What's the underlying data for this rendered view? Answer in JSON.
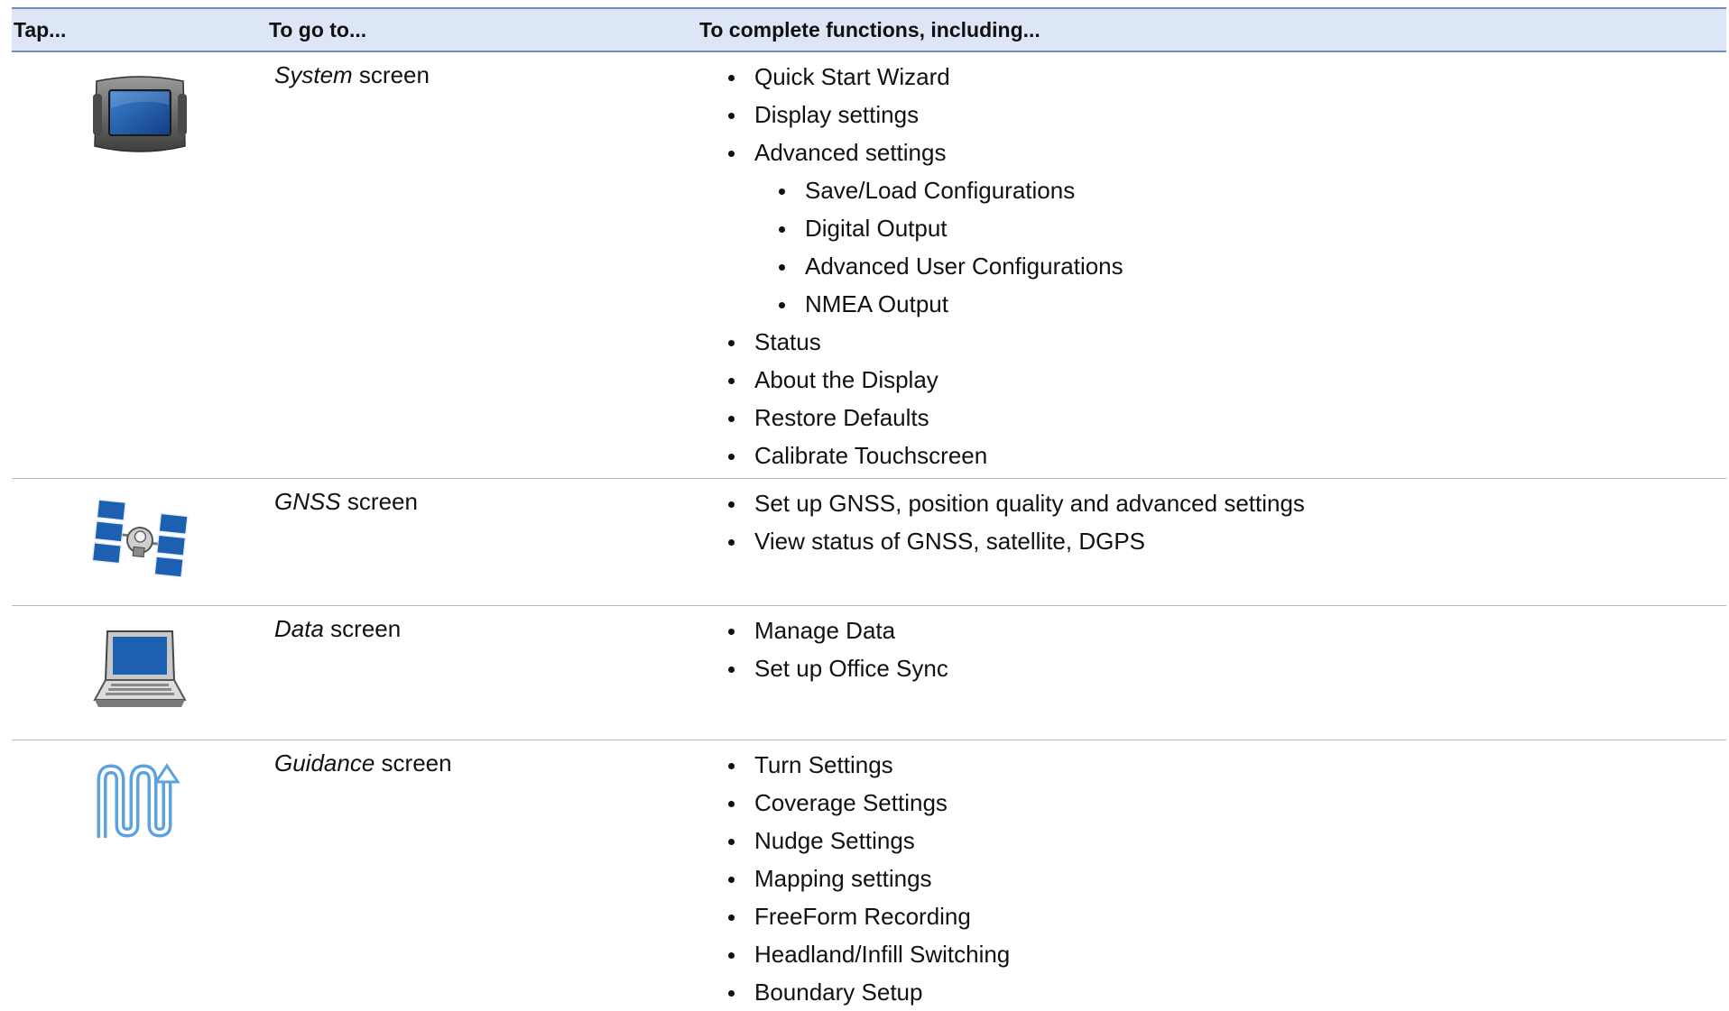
{
  "header": {
    "col_tap": "Tap...",
    "col_goto": "To go to...",
    "col_functions": "To complete functions, including..."
  },
  "rows": [
    {
      "icon": "display-unit-icon",
      "screen_name": "System",
      "screen_suffix": "screen",
      "functions": [
        {
          "text": "Quick Start Wizard",
          "level": 1
        },
        {
          "text": "Display settings",
          "level": 1
        },
        {
          "text": "Advanced settings",
          "level": 1
        },
        {
          "text": "Save/Load Configurations",
          "level": 2
        },
        {
          "text": "Digital Output",
          "level": 2
        },
        {
          "text": "Advanced User Configurations",
          "level": 2
        },
        {
          "text": "NMEA Output",
          "level": 2
        },
        {
          "text": "Status",
          "level": 1
        },
        {
          "text": "About the Display",
          "level": 1
        },
        {
          "text": "Restore Defaults",
          "level": 1
        },
        {
          "text": "Calibrate Touchscreen",
          "level": 1
        }
      ]
    },
    {
      "icon": "satellite-icon",
      "screen_name": "GNSS",
      "screen_suffix": "screen",
      "functions": [
        {
          "text": "Set up GNSS, position quality and advanced settings",
          "level": 1
        },
        {
          "text": "View status of GNSS, satellite, DGPS",
          "level": 1
        }
      ]
    },
    {
      "icon": "laptop-icon",
      "screen_name": "Data",
      "screen_suffix": "screen",
      "functions": [
        {
          "text": "Manage Data",
          "level": 1
        },
        {
          "text": "Set up Office Sync",
          "level": 1
        }
      ]
    },
    {
      "icon": "guidance-path-icon",
      "screen_name": "Guidance",
      "screen_suffix": "screen",
      "functions": [
        {
          "text": "Turn Settings",
          "level": 1
        },
        {
          "text": "Coverage Settings",
          "level": 1
        },
        {
          "text": "Nudge Settings",
          "level": 1
        },
        {
          "text": "Mapping settings",
          "level": 1
        },
        {
          "text": "FreeForm Recording",
          "level": 1
        },
        {
          "text": "Headland/Infill Switching",
          "level": 1
        },
        {
          "text": "Boundary Setup",
          "level": 1
        }
      ]
    }
  ],
  "colors": {
    "header_bg": "#dce6f7",
    "header_rule": "#6f8fbf",
    "row_rule": "#b8b8b8",
    "icon_blue": "#1d5fb0"
  }
}
